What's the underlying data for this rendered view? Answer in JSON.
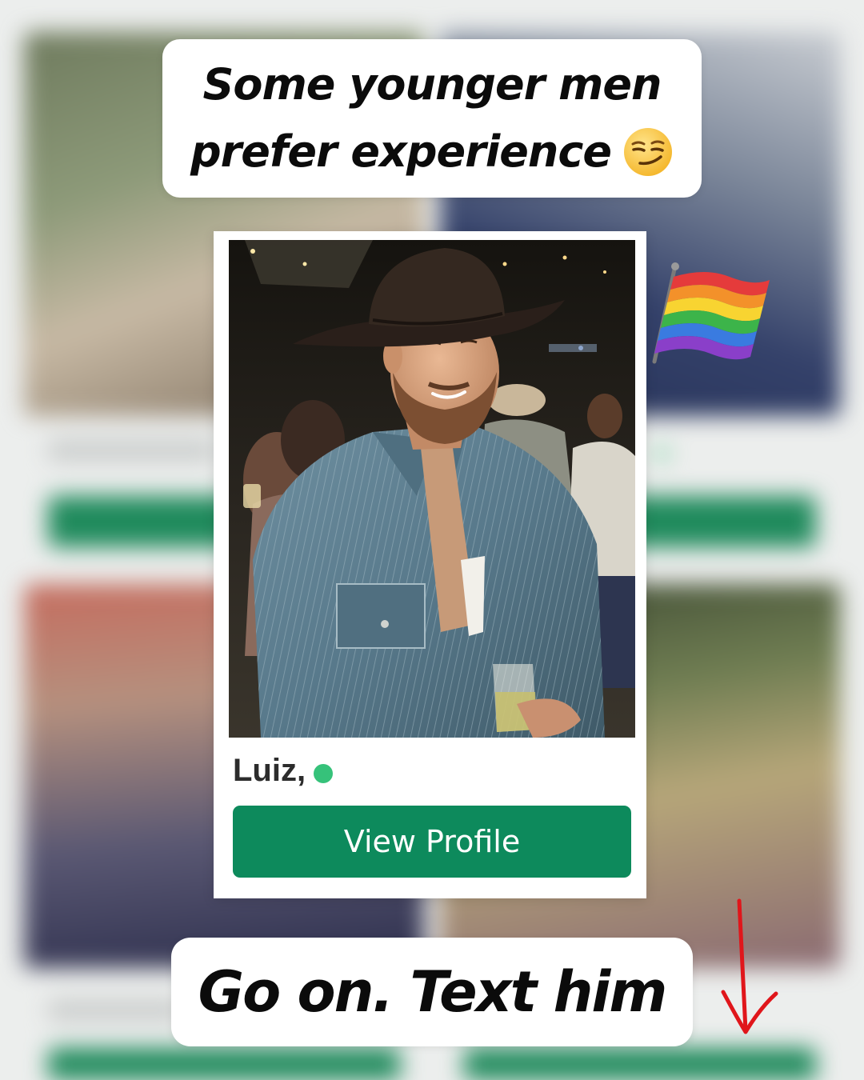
{
  "caption_top": {
    "line1": "Some younger men",
    "line2": "prefer experience",
    "emoji": "smirking-face-icon"
  },
  "profile": {
    "name": "Luiz,",
    "online": true,
    "view_button_label": "View Profile"
  },
  "caption_bottom": {
    "text": "Go on. Text him"
  },
  "decorations": {
    "flag": "rainbow-pride-flag-icon",
    "arrow": "red-down-arrow-icon"
  },
  "colors": {
    "button": "#0d8a5c",
    "online": "#36c27a",
    "arrow": "#e0161b"
  }
}
